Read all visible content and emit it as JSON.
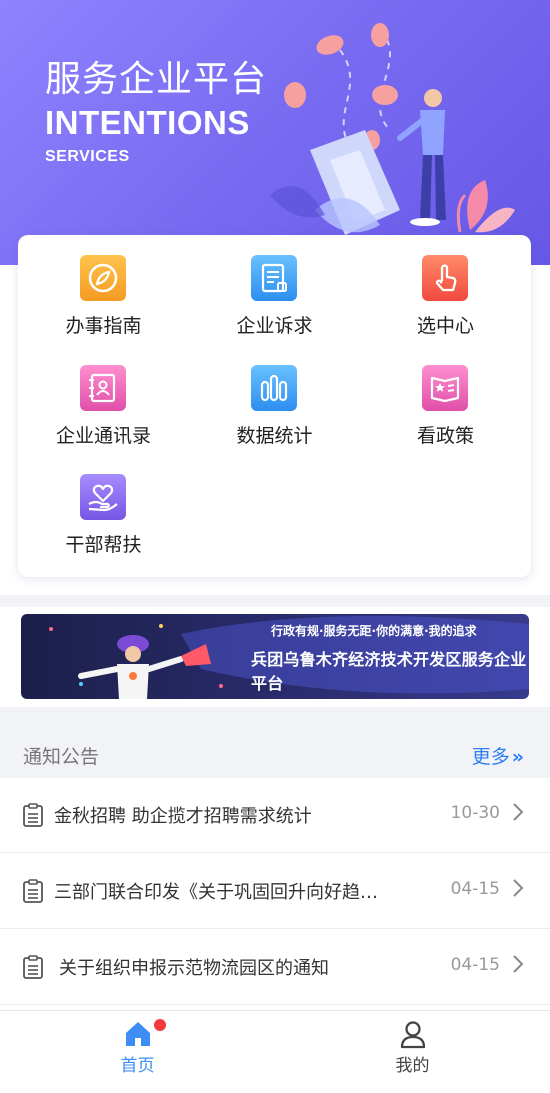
{
  "hero": {
    "title": "服务企业平台",
    "subtitle": "INTENTIONS",
    "subtitle2": "SERVICES"
  },
  "grid": [
    {
      "label": "办事指南",
      "icon": "compass-icon",
      "color": "#f5a623"
    },
    {
      "label": "企业诉求",
      "icon": "document-icon",
      "color": "#3aa0f0"
    },
    {
      "label": "选中心",
      "icon": "tap-hand-icon",
      "color": "#f25a4a"
    },
    {
      "label": "企业通讯录",
      "icon": "contacts-book-icon",
      "color": "#ea5fb5"
    },
    {
      "label": "数据统计",
      "icon": "bar-chart-icon",
      "color": "#3aa0f0"
    },
    {
      "label": "看政策",
      "icon": "policy-book-icon",
      "color": "#ea5fb5"
    },
    {
      "label": "干部帮扶",
      "icon": "heart-hand-icon",
      "color": "#8a66e8"
    }
  ],
  "banner": {
    "line1": "行政有规·服务无距·你的满意·我的追求",
    "line2": "兵团乌鲁木齐经济技术开发区服务企业平台"
  },
  "notices": {
    "title": "通知公告",
    "more": "更多",
    "items": [
      {
        "text": "金秋招聘 助企揽才招聘需求统计",
        "date": "10-30"
      },
      {
        "text": "三部门联合印发《关于巩固回升向好趋…",
        "date": "04-15"
      },
      {
        "text": "关于组织申报示范物流园区的通知",
        "date": "04-15"
      }
    ]
  },
  "tabs": {
    "home": "首页",
    "mine": "我的"
  },
  "colors": {
    "accent": "#2f7ef6",
    "hero": "#7a6df2",
    "badge": "#f23a3a"
  }
}
